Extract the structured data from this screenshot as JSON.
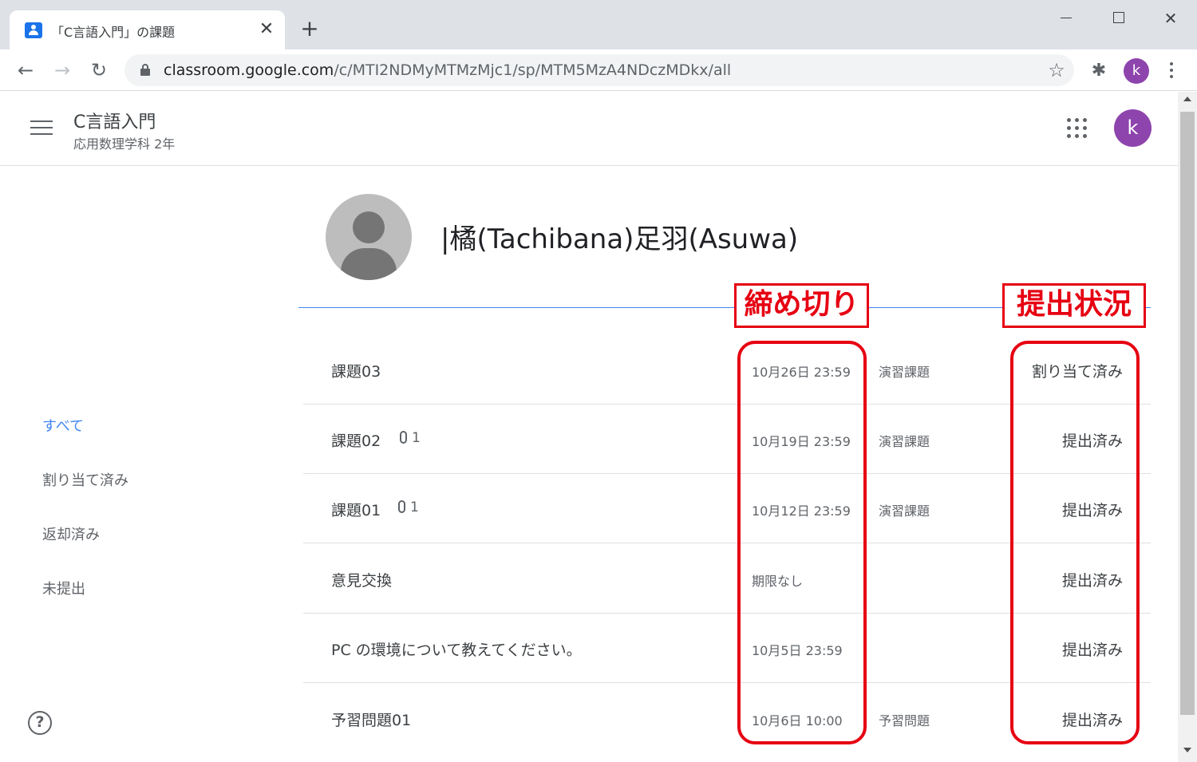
{
  "browser": {
    "tab_title": "「C言語入門」の課題",
    "tab_close": "✕",
    "new_tab": "+",
    "win_close": "✕",
    "url_host": "classroom.google.com",
    "url_path": "/c/MTI2NDMyMTMzMjc1/sp/MTM5MzA4NDczMDkx/all",
    "profile_initial": "k",
    "icons": {
      "back": "←",
      "forward": "→",
      "reload": "↻",
      "star": "☆",
      "extensions": "✱"
    }
  },
  "header": {
    "course_title": "C言語入門",
    "course_subtitle": "応用数理学科 2年",
    "avatar_initial": "k"
  },
  "sidebar": {
    "items": [
      {
        "label": "すべて",
        "active": true
      },
      {
        "label": "割り当て済み",
        "active": false
      },
      {
        "label": "返却済み",
        "active": false
      },
      {
        "label": "未提出",
        "active": false
      }
    ],
    "help_glyph": "?"
  },
  "student": {
    "name": "|橘(Tachibana)足羽(Asuwa)"
  },
  "assignments": [
    {
      "title": "課題03",
      "attachments": "",
      "due": "10月26日 23:59",
      "type": "演習課題",
      "status": "割り当て済み"
    },
    {
      "title": "課題02",
      "attachments": "1",
      "due": "10月19日 23:59",
      "type": "演習課題",
      "status": "提出済み"
    },
    {
      "title": "課題01",
      "attachments": "1",
      "due": "10月12日 23:59",
      "type": "演習課題",
      "status": "提出済み"
    },
    {
      "title": "意見交換",
      "attachments": "",
      "due": "期限なし",
      "type": "",
      "status": "提出済み"
    },
    {
      "title": "PC の環境について教えてください。",
      "attachments": "",
      "due": "10月5日 23:59",
      "type": "",
      "status": "提出済み"
    },
    {
      "title": "予習問題01",
      "attachments": "",
      "due": "10月6日 10:00",
      "type": "予習問題",
      "status": "提出済み"
    }
  ],
  "annotations": {
    "deadline_label": "締め切り",
    "status_label": "提出状況",
    "color": "#e60012"
  },
  "colors": {
    "accent_blue": "#4285f4",
    "avatar_purple": "#8e44ad"
  }
}
